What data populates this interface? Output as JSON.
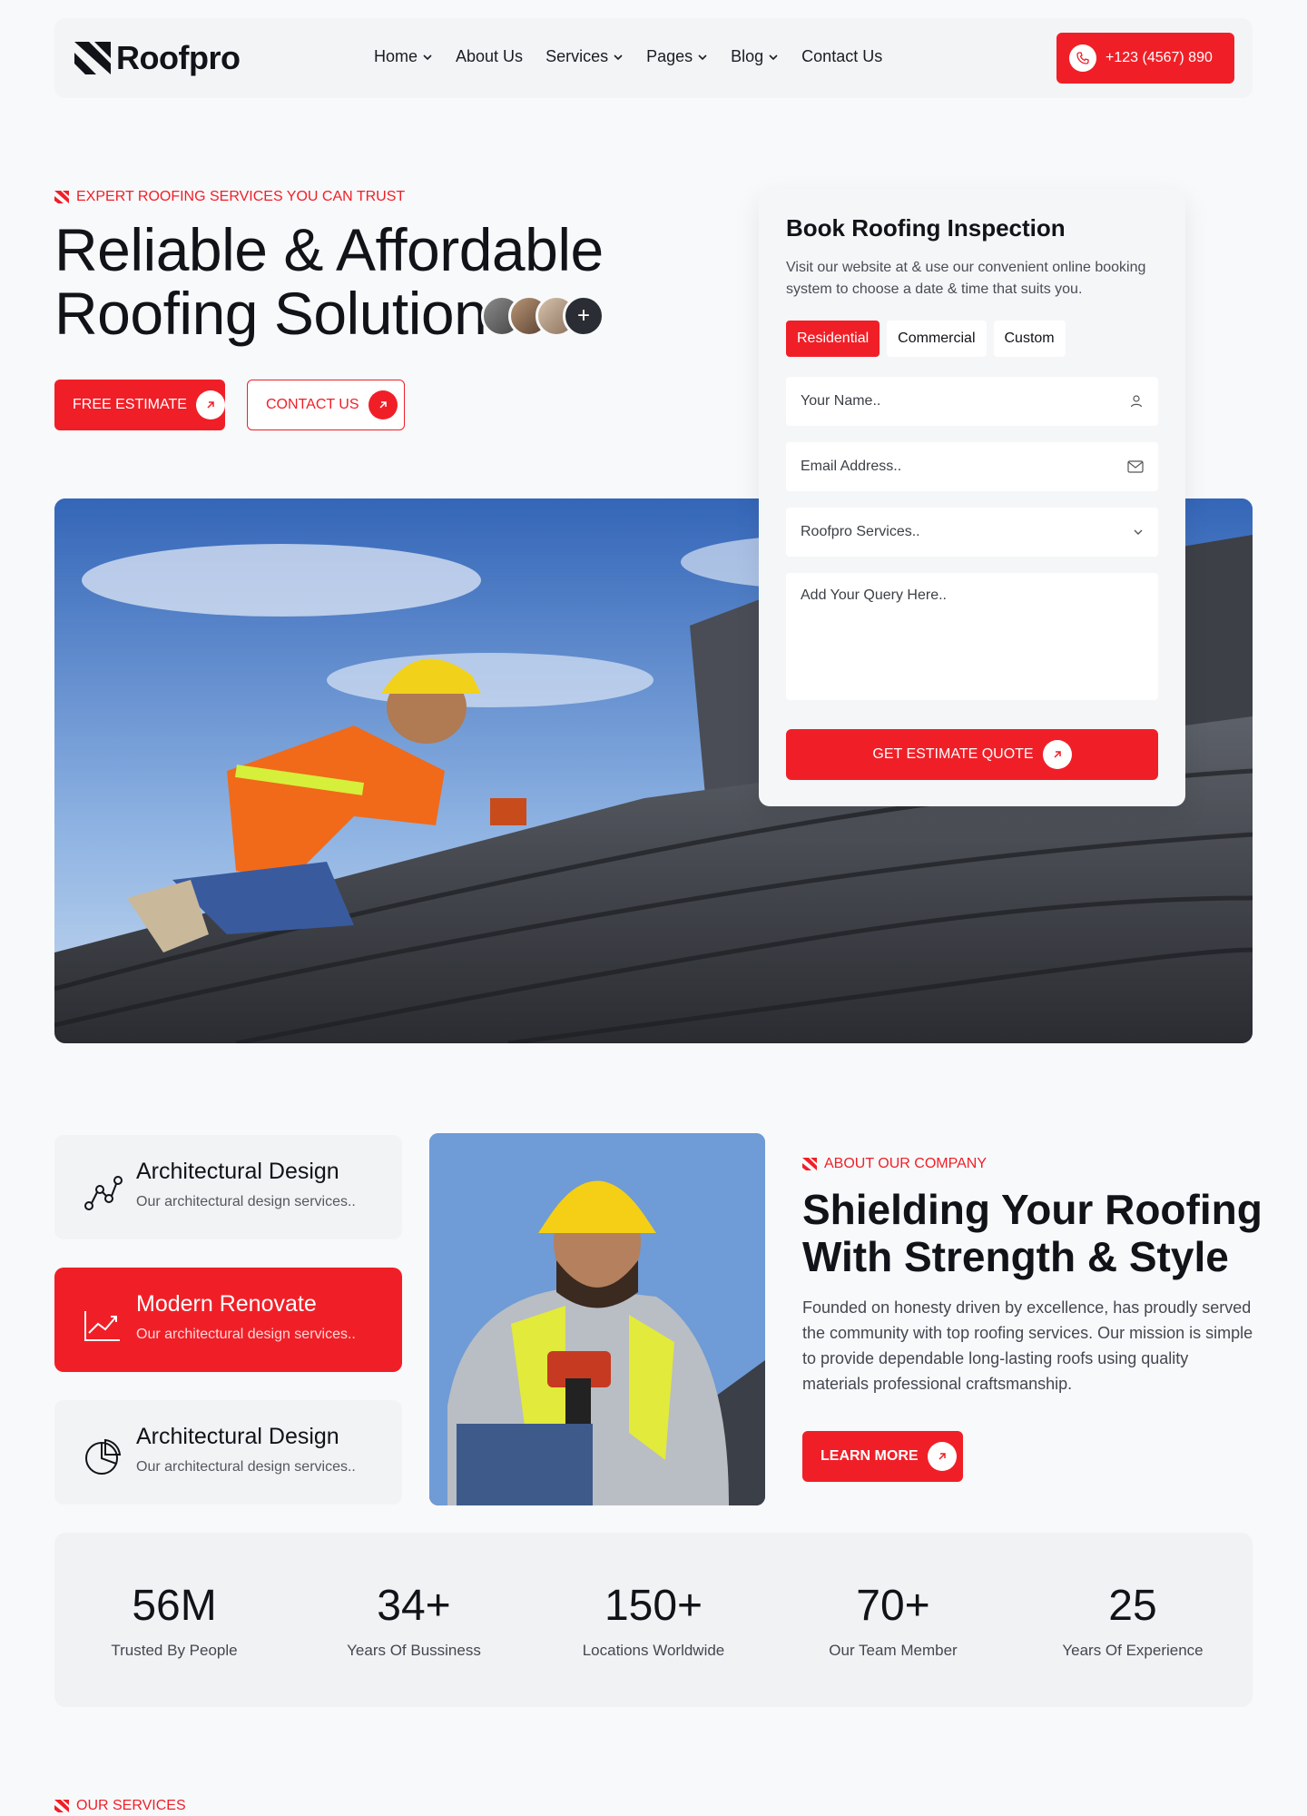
{
  "nav": {
    "brand": "Roofpro",
    "menu": [
      {
        "label": "Home",
        "dropdown": true
      },
      {
        "label": "About Us",
        "dropdown": false
      },
      {
        "label": "Services",
        "dropdown": true
      },
      {
        "label": "Pages",
        "dropdown": true
      },
      {
        "label": "Blog",
        "dropdown": true
      },
      {
        "label": "Contact Us",
        "dropdown": false
      }
    ],
    "phone": "+123 (4567) 890"
  },
  "hero": {
    "tagline": "EXPERT ROOFING SERVICES YOU CAN TRUST",
    "title_line1": "Reliable & Affordable",
    "title_line2": "Roofing Solution",
    "avatar_plus": "+",
    "btn_estimate": "FREE ESTIMATE",
    "btn_contact": "CONTACT US"
  },
  "booking": {
    "title": "Book Roofing Inspection",
    "description": "Visit our website at & use our convenient online booking system to choose a date & time that suits you.",
    "tabs": [
      "Residential",
      "Commercial",
      "Custom"
    ],
    "active_tab": "Residential",
    "name_placeholder": "Your Name..",
    "email_placeholder": "Email Address..",
    "service_placeholder": "Roofpro Services..",
    "query_placeholder": "Add Your Query Here..",
    "submit": "GET ESTIMATE QUOTE"
  },
  "features": [
    {
      "title": "Architectural Design",
      "desc": "Our architectural design services..",
      "icon": "network-icon",
      "active": false
    },
    {
      "title": "Modern Renovate",
      "desc": "Our architectural design services..",
      "icon": "chart-trend-icon",
      "active": true
    },
    {
      "title": "Architectural Design",
      "desc": "Our architectural design services..",
      "icon": "pie-chart-icon",
      "active": false
    }
  ],
  "about": {
    "tag": "ABOUT OUR COMPANY",
    "title_line1": "Shielding Your Roofing",
    "title_line2": "With Strength & Style",
    "description": "Founded on honesty driven by excellence, has proudly served the community with top roofing services. Our mission is simple to provide dependable long-lasting roofs using quality materials professional craftsmanship.",
    "btn": "LEARN MORE"
  },
  "stats": [
    {
      "value": "56M",
      "label": "Trusted By People"
    },
    {
      "value": "34+",
      "label": "Years Of Bussiness"
    },
    {
      "value": "150+",
      "label": "Locations Worldwide"
    },
    {
      "value": "70+",
      "label": "Our Team Member"
    },
    {
      "value": "25",
      "label": "Years Of Experience"
    }
  ],
  "services": {
    "tag": "OUR SERVICES"
  },
  "colors": {
    "accent": "#f01f27",
    "text": "#111318",
    "background": "#f8f9fb"
  }
}
